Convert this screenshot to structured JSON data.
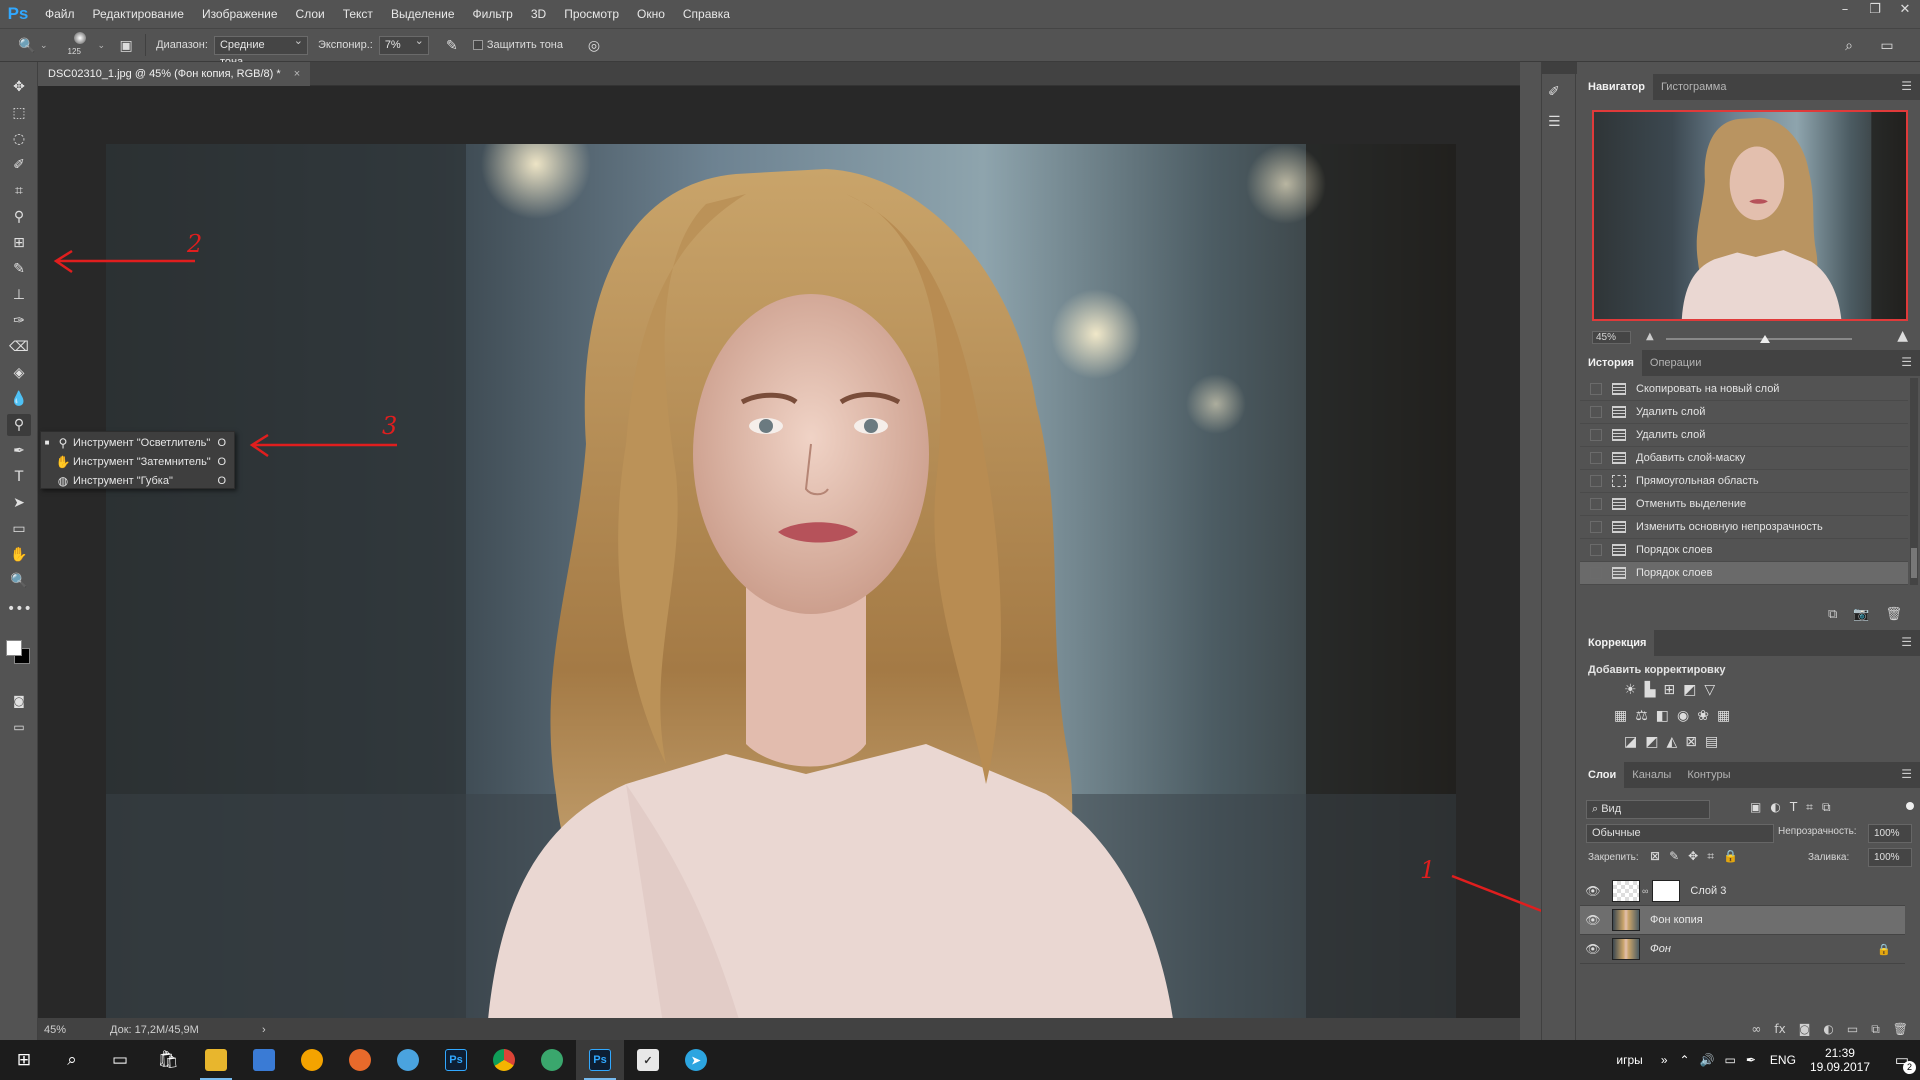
{
  "app": {
    "logo": "Ps"
  },
  "menu": [
    "Файл",
    "Редактирование",
    "Изображение",
    "Слои",
    "Текст",
    "Выделение",
    "Фильтр",
    "3D",
    "Просмотр",
    "Окно",
    "Справка"
  ],
  "window_controls": {
    "minimize": "–",
    "restore": "❐",
    "close": "✕"
  },
  "options": {
    "brush_size": "125",
    "range_label": "Диапазон:",
    "range_value": "Средние тона",
    "exposure_label": "Экспонир.:",
    "exposure_value": "7%",
    "protect_label": "Защитить тона"
  },
  "document": {
    "tab_title": "DSC02310_1.jpg @ 45% (Фон копия, RGB/8) *",
    "tab_close": "×",
    "status_zoom": "45%",
    "status_doc": "Док: 17,2M/45,9M",
    "status_arrow": "›"
  },
  "flyout": {
    "items": [
      {
        "label": "Инструмент \"Осветлитель\"",
        "key": "O",
        "selected": true
      },
      {
        "label": "Инструмент \"Затемнитель\"",
        "key": "O",
        "selected": false
      },
      {
        "label": "Инструмент \"Губка\"",
        "key": "O",
        "selected": false
      }
    ]
  },
  "annotations": {
    "one": "1",
    "two": "2",
    "three": "3"
  },
  "navigator": {
    "tabs": [
      "Навигатор",
      "Гистограмма"
    ],
    "zoom": "45%",
    "zoom_level": 0.53
  },
  "history": {
    "tabs": [
      "История",
      "Операции"
    ],
    "items": [
      {
        "label": "Скопировать на новый слой",
        "icon": "doc"
      },
      {
        "label": "Удалить слой",
        "icon": "doc"
      },
      {
        "label": "Удалить слой",
        "icon": "doc"
      },
      {
        "label": "Добавить слой-маску",
        "icon": "doc"
      },
      {
        "label": "Прямоугольная область",
        "icon": "marquee"
      },
      {
        "label": "Отменить выделение",
        "icon": "doc"
      },
      {
        "label": "Изменить основную непрозрачность",
        "icon": "doc"
      },
      {
        "label": "Порядок слоев",
        "icon": "doc"
      },
      {
        "label": "Порядок слоев",
        "icon": "doc"
      }
    ]
  },
  "correction": {
    "tab": "Коррекция",
    "subtitle": "Добавить корректировку"
  },
  "layers": {
    "tabs": [
      "Слои",
      "Каналы",
      "Контуры"
    ],
    "filter_value": "Вид",
    "blend_mode": "Обычные",
    "opacity_label": "Непрозрачность:",
    "opacity_value": "100%",
    "lock_label": "Закрепить:",
    "fill_label": "Заливка:",
    "fill_value": "100%",
    "items": [
      {
        "name": "Слой 3",
        "selected": false
      },
      {
        "name": "Фон копия",
        "selected": true
      },
      {
        "name": "Фон",
        "selected": false
      }
    ]
  },
  "taskbar": {
    "tray_label": "игры",
    "lang": "ENG",
    "time": "21:39",
    "date": "19.09.2017",
    "notification_count": "2"
  },
  "colors": {
    "accent_ps": "#31a8ff",
    "annotation": "#e01e1e",
    "nav_frame": "#e03a3a"
  }
}
